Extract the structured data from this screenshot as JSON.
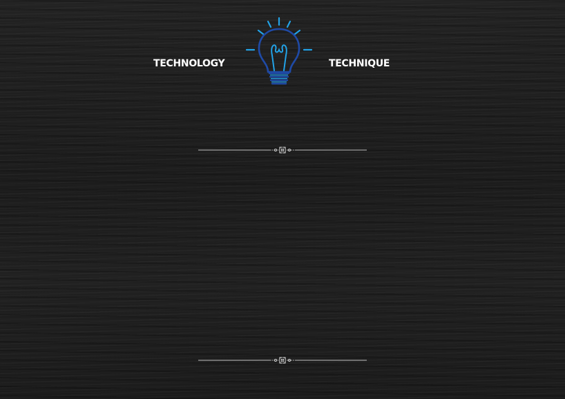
{
  "header": {
    "left_word": "TECHNOLOGY",
    "right_word": "TECHNIQUE",
    "icon": "lightbulb-icon"
  },
  "dividers": [
    {
      "icon": "ornament-divider"
    },
    {
      "icon": "ornament-divider"
    }
  ],
  "colors": {
    "background": "#1e1e1e",
    "text": "#ffffff",
    "bulb_dark_blue": "#1f4aa6",
    "bulb_light_blue": "#22a3e8",
    "divider_line": "#bfbfbf"
  }
}
